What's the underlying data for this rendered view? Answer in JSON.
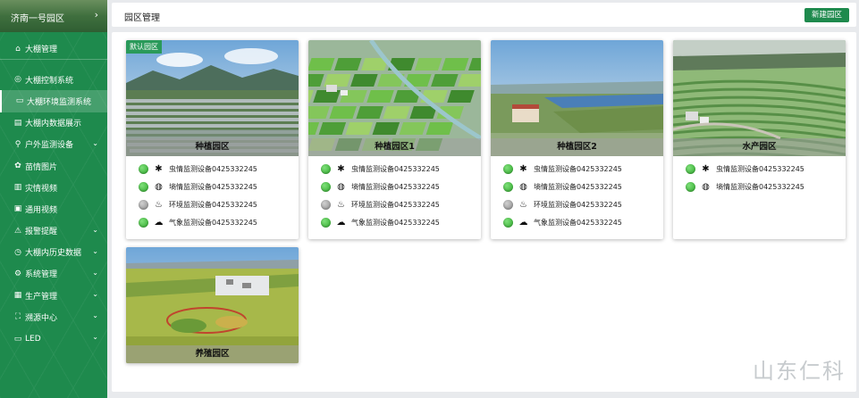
{
  "sidebar": {
    "park_selector": {
      "label": "济南一号园区",
      "chevron": "›"
    },
    "items": [
      {
        "label": "大棚管理",
        "icon": "home-icon",
        "glyph": "⌂",
        "arrow": ""
      },
      {
        "label": "大棚控制系统",
        "icon": "control-icon",
        "glyph": "◎",
        "arrow": ""
      },
      {
        "label": "大棚环境监测系统",
        "icon": "monitor-icon",
        "glyph": "▭",
        "arrow": ""
      },
      {
        "label": "大棚内数据展示",
        "icon": "data-icon",
        "glyph": "▤",
        "arrow": ""
      },
      {
        "label": "户外监测设备",
        "icon": "outdoor-icon",
        "glyph": "⚲",
        "arrow": "⌄"
      },
      {
        "label": "苗情图片",
        "icon": "seedling-icon",
        "glyph": "✿",
        "arrow": ""
      },
      {
        "label": "灾情视频",
        "icon": "chart-icon",
        "glyph": "▥",
        "arrow": ""
      },
      {
        "label": "通用视频",
        "icon": "video-icon",
        "glyph": "▣",
        "arrow": ""
      },
      {
        "label": "报警提醒",
        "icon": "alarm-icon",
        "glyph": "⚠",
        "arrow": "⌄"
      },
      {
        "label": "大棚内历史数据",
        "icon": "history-icon",
        "glyph": "◷",
        "arrow": "⌄"
      },
      {
        "label": "系统管理",
        "icon": "settings-icon",
        "glyph": "⚙",
        "arrow": "⌄"
      },
      {
        "label": "生产管理",
        "icon": "grid-icon",
        "glyph": "▦",
        "arrow": "⌄"
      },
      {
        "label": "溯源中心",
        "icon": "trace-icon",
        "glyph": "⛶",
        "arrow": "⌄"
      },
      {
        "label": "LED",
        "icon": "led-icon",
        "glyph": "▭",
        "arrow": "⌄"
      }
    ],
    "active_index": 2
  },
  "header": {
    "title": "园区管理",
    "new_button": "新建园区"
  },
  "cards": [
    {
      "name": "种植园区",
      "badge": "默认园区",
      "scene": "greenhouse",
      "devices": [
        {
          "status": "green",
          "icon": "bug-icon",
          "glyph": "✱",
          "label": "虫情监测设备0425332245"
        },
        {
          "status": "green",
          "icon": "soil-icon",
          "glyph": "◍",
          "label": "墒情监测设备0425332245"
        },
        {
          "status": "gray",
          "icon": "env-icon",
          "glyph": "♨",
          "label": "环境监测设备0425332245"
        },
        {
          "status": "green",
          "icon": "weather-icon",
          "glyph": "☁",
          "label": "气象监测设备0425332245"
        }
      ]
    },
    {
      "name": "种植园区1",
      "badge": "",
      "scene": "fields",
      "devices": [
        {
          "status": "green",
          "icon": "bug-icon",
          "glyph": "✱",
          "label": "虫情监测设备0425332245"
        },
        {
          "status": "green",
          "icon": "soil-icon",
          "glyph": "◍",
          "label": "墒情监测设备0425332245"
        },
        {
          "status": "gray",
          "icon": "env-icon",
          "glyph": "♨",
          "label": "环境监测设备0425332245"
        },
        {
          "status": "green",
          "icon": "weather-icon",
          "glyph": "☁",
          "label": "气象监测设备0425332245"
        }
      ]
    },
    {
      "name": "种植园区2",
      "badge": "",
      "scene": "farm",
      "devices": [
        {
          "status": "green",
          "icon": "bug-icon",
          "glyph": "✱",
          "label": "虫情监测设备0425332245"
        },
        {
          "status": "green",
          "icon": "soil-icon",
          "glyph": "◍",
          "label": "墒情监测设备0425332245"
        },
        {
          "status": "gray",
          "icon": "env-icon",
          "glyph": "♨",
          "label": "环境监测设备0425332245"
        },
        {
          "status": "green",
          "icon": "weather-icon",
          "glyph": "☁",
          "label": "气象监测设备0425332245"
        }
      ]
    },
    {
      "name": "水产园区",
      "badge": "",
      "scene": "terrace",
      "devices": [
        {
          "status": "green",
          "icon": "bug-icon",
          "glyph": "✱",
          "label": "虫情监测设备0425332245"
        },
        {
          "status": "green",
          "icon": "soil-icon",
          "glyph": "◍",
          "label": "墒情监测设备0425332245"
        }
      ]
    },
    {
      "name": "养殖园区",
      "badge": "",
      "scene": "village",
      "devices": []
    }
  ],
  "watermark": "山东仁科",
  "colors": {
    "brand": "#1e8a4d",
    "status_ok": "#2da82a",
    "status_off": "#8a8a8a"
  }
}
